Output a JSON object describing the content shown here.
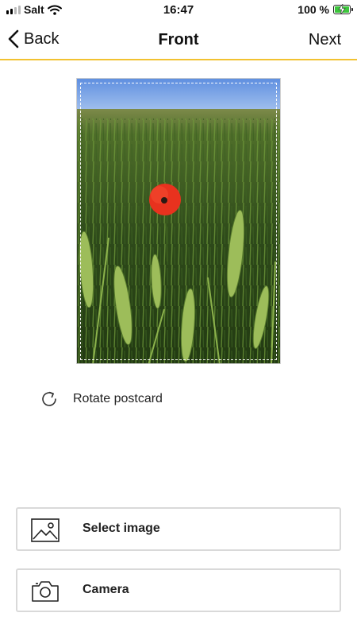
{
  "status_bar": {
    "carrier": "Salt",
    "time": "16:47",
    "battery_percent": "100 %",
    "battery_color": "#3cc63c"
  },
  "nav": {
    "back_label": "Back",
    "title": "Front",
    "next_label": "Next",
    "accent_color": "#f2c231"
  },
  "photo": {
    "subject": "wheat-field-with-red-poppy",
    "crop_guide": "dashed-frame"
  },
  "rotate": {
    "label": "Rotate postcard",
    "icon": "rotate-icon"
  },
  "actions": [
    {
      "label": "Select image",
      "icon": "image-icon"
    },
    {
      "label": "Camera",
      "icon": "camera-icon"
    }
  ]
}
